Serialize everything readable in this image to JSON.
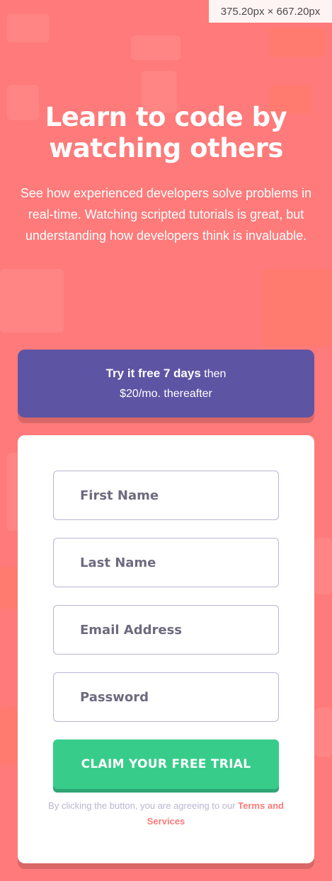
{
  "viewport_badge": "375.20px × 667.20px",
  "hero": {
    "headline_line1": "Learn to code by",
    "headline_line2": "watching others",
    "subtext": "See how experienced developers solve problems in real-time. Watching scripted tutorials is great, but understanding how developers think is invaluable."
  },
  "promo": {
    "bold": "Try it free 7 days",
    "rest": " then",
    "line2": "$20/mo. thereafter"
  },
  "form": {
    "first_name_placeholder": "First Name",
    "last_name_placeholder": "Last Name",
    "email_placeholder": "Email Address",
    "password_placeholder": "Password",
    "submit_label": "CLAIM YOUR FREE TRIAL",
    "terms_prefix": "By clicking the button, you are agreeing to our",
    "terms_link": "Terms and Services"
  },
  "colors": {
    "background": "#ff7a7a",
    "promo": "#5e54a4",
    "cta": "#38cc8b",
    "input_border": "#b9b6d3",
    "terms_text": "#b9b6d3"
  }
}
